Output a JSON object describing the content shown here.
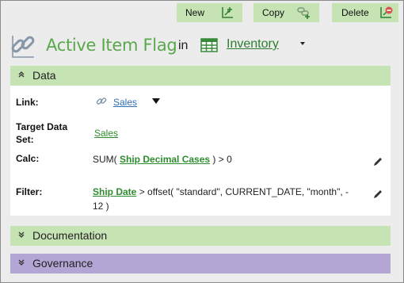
{
  "toolbar": {
    "new_label": "New",
    "copy_label": "Copy",
    "delete_label": "Delete"
  },
  "header": {
    "title": "Active Item Flag",
    "in_word": "in",
    "table_name": "Inventory"
  },
  "sections": {
    "data": {
      "title": "Data",
      "link_label": "Link:",
      "link_value": "Sales",
      "target_label_1": "Target Data",
      "target_label_2": "Set:",
      "target_value": "Sales",
      "calc_label": "Calc:",
      "calc_prefix": "SUM(",
      "calc_field": "Ship Decimal Cases",
      "calc_suffix": ") > 0",
      "filter_label": "Filter:",
      "filter_field": "Ship Date",
      "filter_rest_1": "> offset( \"standard\", CURRENT_DATE, \"month\", -",
      "filter_rest_2": "12 )"
    },
    "documentation": {
      "title": "Documentation"
    },
    "governance": {
      "title": "Governance"
    }
  },
  "colors": {
    "section_green": "#c5e3b3",
    "section_purple": "#b3a6d4",
    "title_green": "#5aa84c",
    "link_blue": "#2e6fb5",
    "field_green": "#2e8b2e"
  },
  "icons": {
    "new": "add-grid-icon",
    "copy": "copy-link-icon",
    "delete": "delete-grid-icon",
    "title": "chain-link-icon",
    "table": "table-grid-icon",
    "edit": "pencil-icon"
  }
}
